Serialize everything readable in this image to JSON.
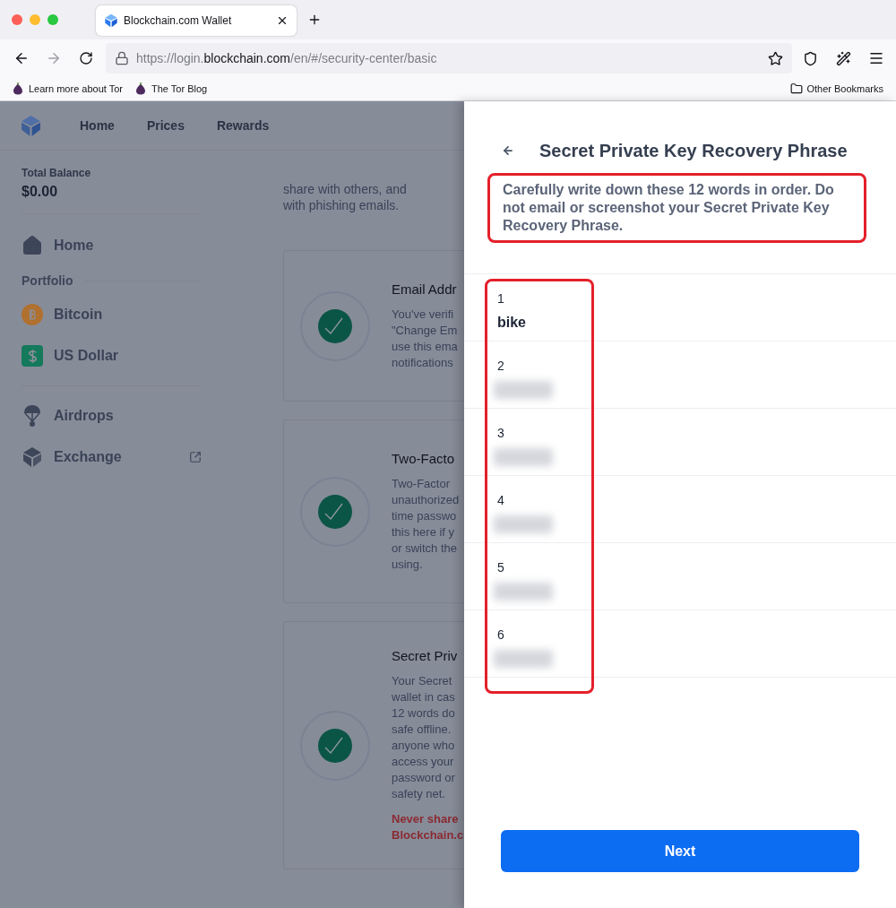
{
  "browser": {
    "tab_title": "Blockchain.com Wallet",
    "url": {
      "scheme": "https://login.",
      "host": "blockchain.com",
      "path": "/en/#/security-center/basic"
    },
    "bookmarks": [
      "Learn more about Tor",
      "The Tor Blog"
    ],
    "other_bookmarks": "Other Bookmarks"
  },
  "app": {
    "nav": [
      "Home",
      "Prices",
      "Rewards"
    ],
    "sidebar": {
      "balance_label": "Total Balance",
      "balance": "$0.00",
      "items": [
        {
          "kind": "home",
          "label": "Home"
        },
        {
          "kind": "heading",
          "label": "Portfolio"
        },
        {
          "kind": "bitcoin",
          "label": "Bitcoin"
        },
        {
          "kind": "dollar",
          "label": "US Dollar"
        },
        {
          "kind": "airdrops",
          "label": "Airdrops"
        },
        {
          "kind": "exchange",
          "label": "Exchange"
        }
      ]
    },
    "intro_lines": [
      "share with others, and",
      "with phishing emails."
    ],
    "cards": [
      {
        "title": "Email Addr",
        "lines": [
          "You've verifi",
          "\"Change Em",
          "use this ema",
          "notifications"
        ]
      },
      {
        "title": "Two-Facto",
        "lines": [
          "Two-Factor",
          "unauthorized",
          "time passwo",
          "this here if y",
          "or switch the",
          "using."
        ]
      },
      {
        "title": "Secret Priv",
        "lines": [
          "Your Secret",
          "wallet in cas",
          "12 words do",
          "safe offline.",
          "anyone who",
          "access your",
          "password or",
          "safety net."
        ],
        "warning_lines": [
          "Never share",
          "Blockchain.c"
        ]
      }
    ]
  },
  "panel": {
    "title": "Secret Private Key Recovery Phrase",
    "description": "Carefully write down these 12 words in order. Do not email or screenshot your Secret Private Key Recovery Phrase.",
    "description_outlined": true,
    "words_outlined": true,
    "words": [
      {
        "number": "1",
        "word": "bike",
        "blurred": false
      },
      {
        "number": "2",
        "blurred": true
      },
      {
        "number": "3",
        "blurred": true
      },
      {
        "number": "4",
        "blurred": true
      },
      {
        "number": "5",
        "blurred": true
      },
      {
        "number": "6",
        "blurred": true
      }
    ],
    "button": "Next"
  }
}
